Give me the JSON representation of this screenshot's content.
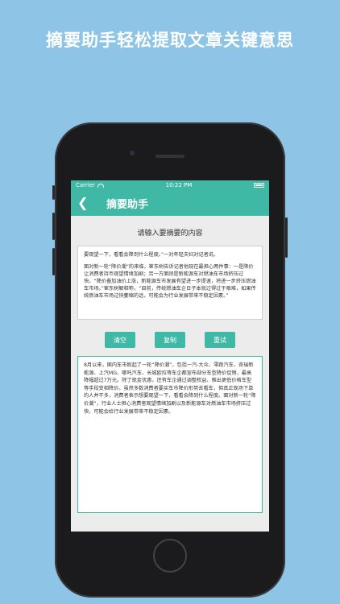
{
  "headline": {
    "part1": "摘要助手轻松提取文章",
    "part2": "关键意思"
  },
  "status": {
    "carrier": "Carrier",
    "time": "10:22 PM"
  },
  "nav": {
    "title": "摘要助手",
    "back_icon": "chevron-left-icon"
  },
  "prompt": "请输入要摘要的内容",
  "input": {
    "paragraphs": [
      "要观望一下，看看会降到什么程度。”一对年轻夫妇对记者说。",
      "面对新一轮“降价潮”的来临，崔东树告诉记者他现在最担心两件事：一是降价让消费者持币观望情绪加剧；另一方面则是新能源车对燃油车市场挤压过快。“降价叠加油价上涨，新能源车市发展有望进一步提速，将进一步挤压燃油车市场。”崔东树解释称，“目前，传统燃油车企日子本就过得过于艰难，如果传统燃油车市场过快萎缩的话，可能会为行业发展带来不稳定因素。”"
    ]
  },
  "buttons": {
    "clear": "清空",
    "copy": "复制",
    "retry": "重试"
  },
  "output": {
    "text": "8月以来，国内车市掀起了一轮“降价潮”，包括一汽-大众、零跑汽车、奇瑞新能源、上汽MG、哪吒汽车、长城欧拉等车企都宣布部分车型降价促销，最高降幅超过7万元。除了现金优惠，还有车企通过调整权益、推出更低价格车型等手段变相降价。虽然多数消费者要买车市降价形势去看车，但真正现场下单的人并不多，消费者表示想要观望一下，看看会降到什么程度。面对新一轮“降价潮”，行业人士担心消费者观望情绪加剧以及新能源车对燃油车市场挤压过快，可能会给行业发展带来不稳定因素。"
  }
}
